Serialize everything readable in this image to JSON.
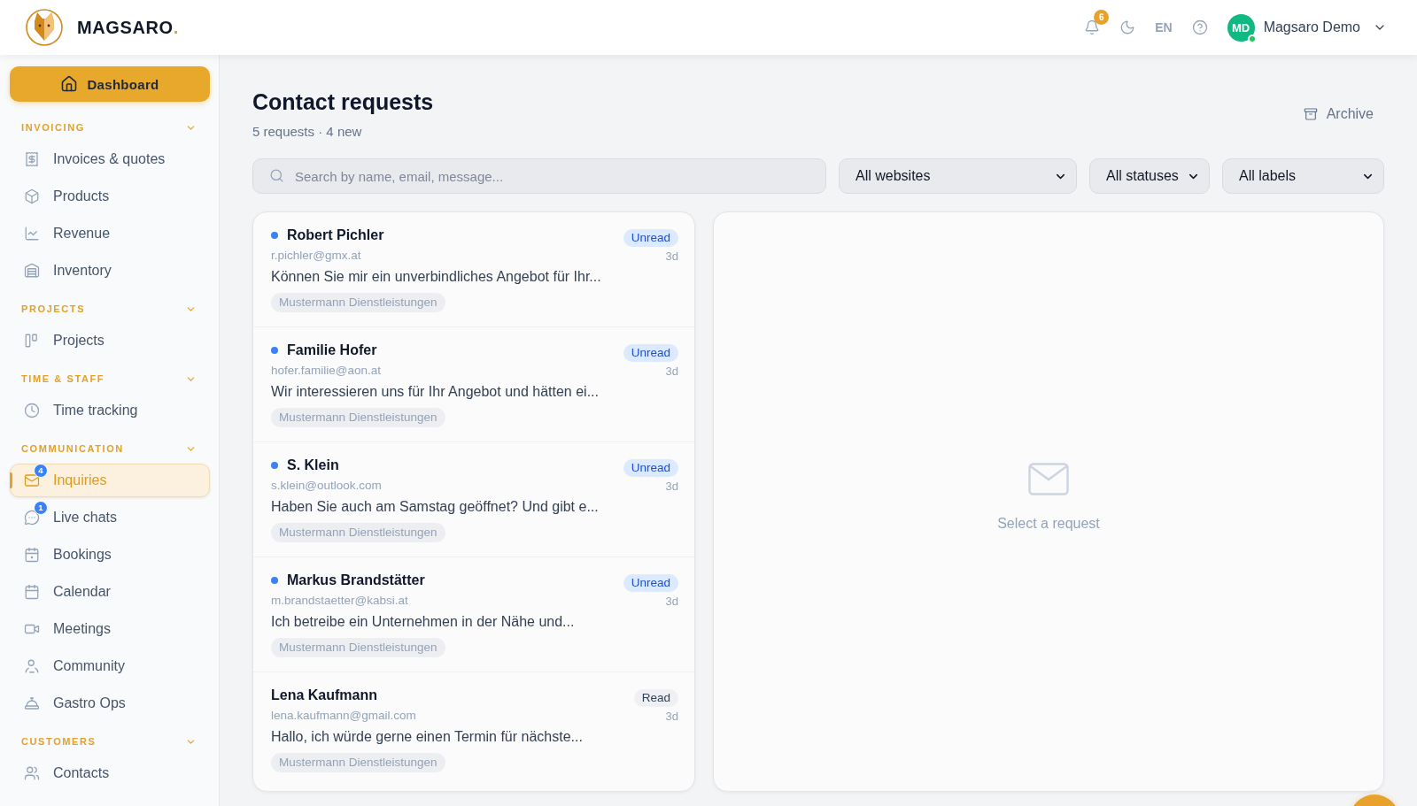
{
  "header": {
    "brand": {
      "name": "MAGSARO",
      "accent": "."
    },
    "notifications": {
      "count": "6"
    },
    "language": "EN",
    "user": {
      "initials": "MD",
      "name": "Magsaro Demo",
      "online": true
    }
  },
  "sidebar": {
    "dashboard": "Dashboard",
    "sections": [
      {
        "title": "INVOICING",
        "expanded": true,
        "items": [
          {
            "label": "Invoices & quotes",
            "selected": false
          },
          {
            "label": "Products",
            "selected": false
          },
          {
            "label": "Revenue",
            "selected": false
          },
          {
            "label": "Inventory",
            "selected": false
          }
        ]
      },
      {
        "title": "PROJECTS",
        "expanded": true,
        "items": [
          {
            "label": "Projects",
            "selected": false
          }
        ]
      },
      {
        "title": "TIME & STAFF",
        "expanded": true,
        "items": [
          {
            "label": "Time tracking",
            "selected": false
          }
        ]
      },
      {
        "title": "COMMUNICATION",
        "expanded": true,
        "items": [
          {
            "label": "Inquiries",
            "selected": true,
            "badge": "4"
          },
          {
            "label": "Live chats",
            "selected": false,
            "badge": "1"
          },
          {
            "label": "Bookings",
            "selected": false
          },
          {
            "label": "Calendar",
            "selected": false
          },
          {
            "label": "Meetings",
            "selected": false
          },
          {
            "label": "Community",
            "selected": false
          },
          {
            "label": "Gastro Ops",
            "selected": false
          }
        ]
      },
      {
        "title": "CUSTOMERS",
        "expanded": true,
        "items": [
          {
            "label": "Contacts",
            "selected": false
          }
        ]
      }
    ]
  },
  "main": {
    "title": "Contact requests",
    "subtitle": "5 requests · 4 new",
    "archive_button": "Archive",
    "search": {
      "placeholder": "Search by name, email, message..."
    },
    "filters": [
      {
        "value": "All websites"
      },
      {
        "value": "All statuses"
      },
      {
        "value": "All labels"
      }
    ],
    "requests": [
      {
        "name": "Robert Pichler",
        "email": "r.pichler@gmx.at",
        "message": "Können Sie mir ein unverbindliches Angebot für Ihr...",
        "tag": "Mustermann Dienstleistungen",
        "status": "Unread",
        "unread": true,
        "time": "3d",
        "selected": false
      },
      {
        "name": "Familie Hofer",
        "email": "hofer.familie@aon.at",
        "message": "Wir interessieren uns für Ihr Angebot und hätten ei...",
        "tag": "Mustermann Dienstleistungen",
        "status": "Unread",
        "unread": true,
        "time": "3d",
        "selected": false
      },
      {
        "name": "S. Klein",
        "email": "s.klein@outlook.com",
        "message": "Haben Sie auch am Samstag geöffnet? Und gibt e...",
        "tag": "Mustermann Dienstleistungen",
        "status": "Unread",
        "unread": true,
        "time": "3d",
        "selected": false
      },
      {
        "name": "Markus Brandstätter",
        "email": "m.brandstaetter@kabsi.at",
        "message": "Ich betreibe ein Unternehmen in der Nähe und...",
        "tag": "Mustermann Dienstleistungen",
        "status": "Unread",
        "unread": true,
        "time": "3d",
        "selected": false
      },
      {
        "name": "Lena Kaufmann",
        "email": "lena.kaufmann@gmail.com",
        "message": "Hallo, ich würde gerne einen Termin für nächste...",
        "tag": "Mustermann Dienstleistungen",
        "status": "Read",
        "unread": false,
        "time": "3d",
        "selected": false
      }
    ],
    "detail": {
      "empty_text": "Select a request"
    }
  }
}
